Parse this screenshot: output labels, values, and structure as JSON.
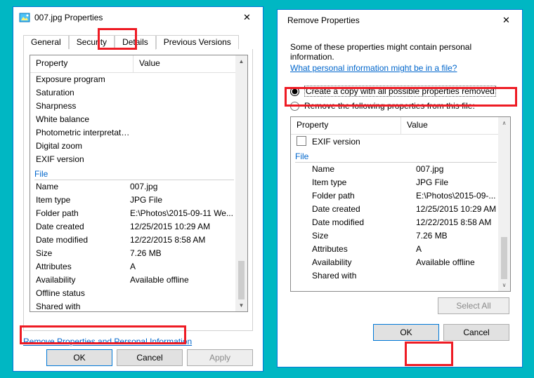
{
  "left": {
    "title": "007.jpg Properties",
    "tabs": [
      "General",
      "Security",
      "Details",
      "Previous Versions"
    ],
    "active_tab_index": 2,
    "headers": {
      "property": "Property",
      "value": "Value"
    },
    "origin_rows": [
      {
        "p": "Exposure program",
        "v": ""
      },
      {
        "p": "Saturation",
        "v": ""
      },
      {
        "p": "Sharpness",
        "v": ""
      },
      {
        "p": "White balance",
        "v": ""
      },
      {
        "p": "Photometric interpretation",
        "v": ""
      },
      {
        "p": "Digital zoom",
        "v": ""
      },
      {
        "p": "EXIF version",
        "v": ""
      }
    ],
    "file_group": "File",
    "file_rows": [
      {
        "p": "Name",
        "v": "007.jpg"
      },
      {
        "p": "Item type",
        "v": "JPG File"
      },
      {
        "p": "Folder path",
        "v": "E:\\Photos\\2015-09-11 We..."
      },
      {
        "p": "Date created",
        "v": "12/25/2015 10:29 AM"
      },
      {
        "p": "Date modified",
        "v": "12/22/2015 8:58 AM"
      },
      {
        "p": "Size",
        "v": "7.26 MB"
      },
      {
        "p": "Attributes",
        "v": "A"
      },
      {
        "p": "Availability",
        "v": "Available offline"
      },
      {
        "p": "Offline status",
        "v": ""
      },
      {
        "p": "Shared with",
        "v": ""
      }
    ],
    "remove_link": "Remove Properties and Personal Information",
    "buttons": {
      "ok": "OK",
      "cancel": "Cancel",
      "apply": "Apply"
    }
  },
  "right": {
    "title": "Remove Properties",
    "intro": "Some of these properties might contain personal information.",
    "info_link": "What personal information might be in a file?",
    "radio1": "Create a copy with all possible properties removed",
    "radio2": "Remove the following properties from this file:",
    "headers": {
      "property": "Property",
      "value": "Value"
    },
    "exif_label": "EXIF version",
    "file_group": "File",
    "file_rows": [
      {
        "p": "Name",
        "v": "007.jpg"
      },
      {
        "p": "Item type",
        "v": "JPG File"
      },
      {
        "p": "Folder path",
        "v": "E:\\Photos\\2015-09-..."
      },
      {
        "p": "Date created",
        "v": "12/25/2015 10:29 AM"
      },
      {
        "p": "Date modified",
        "v": "12/22/2015 8:58 AM"
      },
      {
        "p": "Size",
        "v": "7.26 MB"
      },
      {
        "p": "Attributes",
        "v": "A"
      },
      {
        "p": "Availability",
        "v": "Available offline"
      },
      {
        "p": "Shared with",
        "v": ""
      }
    ],
    "select_all": "Select All",
    "buttons": {
      "ok": "OK",
      "cancel": "Cancel"
    }
  }
}
